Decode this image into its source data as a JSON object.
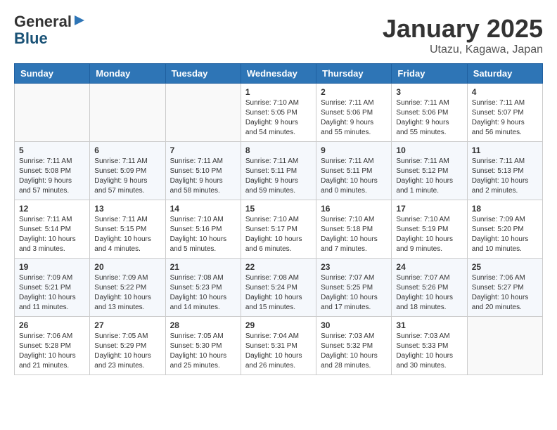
{
  "header": {
    "logo_general": "General",
    "logo_blue": "Blue",
    "month_title": "January 2025",
    "location": "Utazu, Kagawa, Japan"
  },
  "days_of_week": [
    "Sunday",
    "Monday",
    "Tuesday",
    "Wednesday",
    "Thursday",
    "Friday",
    "Saturday"
  ],
  "weeks": [
    [
      {
        "day": "",
        "info": ""
      },
      {
        "day": "",
        "info": ""
      },
      {
        "day": "",
        "info": ""
      },
      {
        "day": "1",
        "info": "Sunrise: 7:10 AM\nSunset: 5:05 PM\nDaylight: 9 hours and 54 minutes."
      },
      {
        "day": "2",
        "info": "Sunrise: 7:11 AM\nSunset: 5:06 PM\nDaylight: 9 hours and 55 minutes."
      },
      {
        "day": "3",
        "info": "Sunrise: 7:11 AM\nSunset: 5:06 PM\nDaylight: 9 hours and 55 minutes."
      },
      {
        "day": "4",
        "info": "Sunrise: 7:11 AM\nSunset: 5:07 PM\nDaylight: 9 hours and 56 minutes."
      }
    ],
    [
      {
        "day": "5",
        "info": "Sunrise: 7:11 AM\nSunset: 5:08 PM\nDaylight: 9 hours and 57 minutes."
      },
      {
        "day": "6",
        "info": "Sunrise: 7:11 AM\nSunset: 5:09 PM\nDaylight: 9 hours and 57 minutes."
      },
      {
        "day": "7",
        "info": "Sunrise: 7:11 AM\nSunset: 5:10 PM\nDaylight: 9 hours and 58 minutes."
      },
      {
        "day": "8",
        "info": "Sunrise: 7:11 AM\nSunset: 5:11 PM\nDaylight: 9 hours and 59 minutes."
      },
      {
        "day": "9",
        "info": "Sunrise: 7:11 AM\nSunset: 5:11 PM\nDaylight: 10 hours and 0 minutes."
      },
      {
        "day": "10",
        "info": "Sunrise: 7:11 AM\nSunset: 5:12 PM\nDaylight: 10 hours and 1 minute."
      },
      {
        "day": "11",
        "info": "Sunrise: 7:11 AM\nSunset: 5:13 PM\nDaylight: 10 hours and 2 minutes."
      }
    ],
    [
      {
        "day": "12",
        "info": "Sunrise: 7:11 AM\nSunset: 5:14 PM\nDaylight: 10 hours and 3 minutes."
      },
      {
        "day": "13",
        "info": "Sunrise: 7:11 AM\nSunset: 5:15 PM\nDaylight: 10 hours and 4 minutes."
      },
      {
        "day": "14",
        "info": "Sunrise: 7:10 AM\nSunset: 5:16 PM\nDaylight: 10 hours and 5 minutes."
      },
      {
        "day": "15",
        "info": "Sunrise: 7:10 AM\nSunset: 5:17 PM\nDaylight: 10 hours and 6 minutes."
      },
      {
        "day": "16",
        "info": "Sunrise: 7:10 AM\nSunset: 5:18 PM\nDaylight: 10 hours and 7 minutes."
      },
      {
        "day": "17",
        "info": "Sunrise: 7:10 AM\nSunset: 5:19 PM\nDaylight: 10 hours and 9 minutes."
      },
      {
        "day": "18",
        "info": "Sunrise: 7:09 AM\nSunset: 5:20 PM\nDaylight: 10 hours and 10 minutes."
      }
    ],
    [
      {
        "day": "19",
        "info": "Sunrise: 7:09 AM\nSunset: 5:21 PM\nDaylight: 10 hours and 11 minutes."
      },
      {
        "day": "20",
        "info": "Sunrise: 7:09 AM\nSunset: 5:22 PM\nDaylight: 10 hours and 13 minutes."
      },
      {
        "day": "21",
        "info": "Sunrise: 7:08 AM\nSunset: 5:23 PM\nDaylight: 10 hours and 14 minutes."
      },
      {
        "day": "22",
        "info": "Sunrise: 7:08 AM\nSunset: 5:24 PM\nDaylight: 10 hours and 15 minutes."
      },
      {
        "day": "23",
        "info": "Sunrise: 7:07 AM\nSunset: 5:25 PM\nDaylight: 10 hours and 17 minutes."
      },
      {
        "day": "24",
        "info": "Sunrise: 7:07 AM\nSunset: 5:26 PM\nDaylight: 10 hours and 18 minutes."
      },
      {
        "day": "25",
        "info": "Sunrise: 7:06 AM\nSunset: 5:27 PM\nDaylight: 10 hours and 20 minutes."
      }
    ],
    [
      {
        "day": "26",
        "info": "Sunrise: 7:06 AM\nSunset: 5:28 PM\nDaylight: 10 hours and 21 minutes."
      },
      {
        "day": "27",
        "info": "Sunrise: 7:05 AM\nSunset: 5:29 PM\nDaylight: 10 hours and 23 minutes."
      },
      {
        "day": "28",
        "info": "Sunrise: 7:05 AM\nSunset: 5:30 PM\nDaylight: 10 hours and 25 minutes."
      },
      {
        "day": "29",
        "info": "Sunrise: 7:04 AM\nSunset: 5:31 PM\nDaylight: 10 hours and 26 minutes."
      },
      {
        "day": "30",
        "info": "Sunrise: 7:03 AM\nSunset: 5:32 PM\nDaylight: 10 hours and 28 minutes."
      },
      {
        "day": "31",
        "info": "Sunrise: 7:03 AM\nSunset: 5:33 PM\nDaylight: 10 hours and 30 minutes."
      },
      {
        "day": "",
        "info": ""
      }
    ]
  ]
}
